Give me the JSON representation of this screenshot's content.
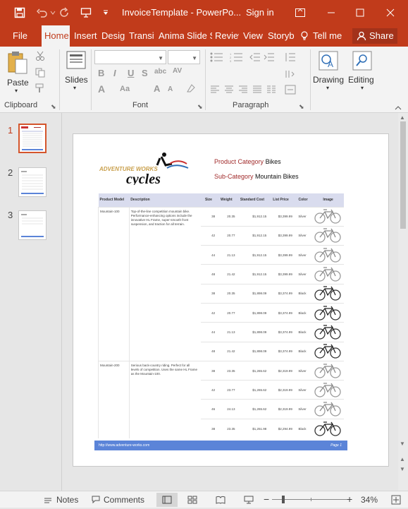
{
  "window": {
    "title": "InvoiceTemplate - PowerPo...",
    "signin": "Sign in"
  },
  "tabs": [
    "File",
    "Home",
    "Insert",
    "Design",
    "Transitions",
    "Animations",
    "Slide Show",
    "Review",
    "View",
    "Storyboarding"
  ],
  "tellme": "Tell me",
  "share": "Share",
  "ribbon": {
    "paste": "Paste",
    "slides": "Slides",
    "drawing": "Drawing",
    "editing": "Editing",
    "groups": {
      "clipboard": "Clipboard",
      "font": "Font",
      "paragraph": "Paragraph"
    }
  },
  "slides_pane": {
    "numbers": [
      "1",
      "2",
      "3"
    ]
  },
  "slide": {
    "logo_top": "ADVENTURE WORKS",
    "logo_bottom": "cycles",
    "category_label": "Product Category",
    "category_value": "Bikes",
    "subcategory_label": "Sub-Category",
    "subcategory_value": "Mountain Bikes",
    "headers": [
      "Product Model",
      "Description",
      "Size",
      "Weight",
      "Standard Cost",
      "List Price",
      "Color",
      "Image"
    ],
    "groups": [
      {
        "model": "Mountain-100",
        "description": "Top-of-the-line competition mountain bike. Performance-enhancing options include the innovative HL Frame, super-smooth front suspension, and traction for all terrain.",
        "rows": [
          {
            "size": "38",
            "weight": "20.35",
            "cost": "$1,912.15",
            "price": "$3,399.99",
            "color": "Silver"
          },
          {
            "size": "42",
            "weight": "20.77",
            "cost": "$1,912.15",
            "price": "$3,399.99",
            "color": "Silver"
          },
          {
            "size": "44",
            "weight": "21.13",
            "cost": "$1,912.15",
            "price": "$3,399.99",
            "color": "Silver"
          },
          {
            "size": "48",
            "weight": "21.42",
            "cost": "$1,912.15",
            "price": "$3,399.99",
            "color": "Silver"
          },
          {
            "size": "38",
            "weight": "20.35",
            "cost": "$1,898.09",
            "price": "$3,374.99",
            "color": "Black"
          },
          {
            "size": "42",
            "weight": "20.77",
            "cost": "$1,898.09",
            "price": "$3,374.99",
            "color": "Black"
          },
          {
            "size": "44",
            "weight": "21.13",
            "cost": "$1,898.09",
            "price": "$3,374.99",
            "color": "Black"
          },
          {
            "size": "48",
            "weight": "21.42",
            "cost": "$1,898.09",
            "price": "$3,374.99",
            "color": "Black"
          }
        ]
      },
      {
        "model": "Mountain-200",
        "description": "Serious back-country riding. Perfect for all levels of competition. Uses the same HL Frame as the Mountain-100.",
        "rows": [
          {
            "size": "38",
            "weight": "23.35",
            "cost": "$1,265.62",
            "price": "$2,319.99",
            "color": "Silver"
          },
          {
            "size": "42",
            "weight": "23.77",
            "cost": "$1,265.62",
            "price": "$2,319.99",
            "color": "Silver"
          },
          {
            "size": "46",
            "weight": "24.13",
            "cost": "$1,265.62",
            "price": "$2,319.99",
            "color": "Silver"
          },
          {
            "size": "38",
            "weight": "23.35",
            "cost": "$1,251.98",
            "price": "$2,294.99",
            "color": "Black"
          }
        ]
      }
    ],
    "footer_url": "http://www.adventure-works.com",
    "footer_page": "Page 1"
  },
  "statusbar": {
    "notes": "Notes",
    "comments": "Comments",
    "zoom": "34%"
  },
  "colors": {
    "accent": "#c13b1b",
    "table_header": "#d9dcee",
    "footer": "#5b84d8",
    "category_label": "#a12b2b"
  }
}
